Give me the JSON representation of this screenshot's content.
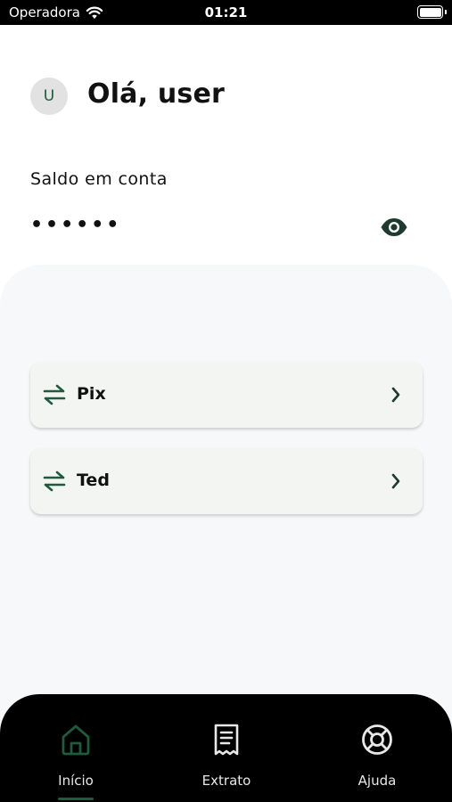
{
  "status_bar": {
    "carrier": "Operadora",
    "time": "01:21"
  },
  "header": {
    "avatar_initial": "U",
    "greeting": "Olá, user"
  },
  "balance": {
    "label": "Saldo em conta",
    "masked_value": "••••••",
    "visibility_icon": "eye-icon"
  },
  "actions": [
    {
      "label": "Pix",
      "icon": "transfer-arrows-icon"
    },
    {
      "label": "Ted",
      "icon": "transfer-arrows-icon"
    }
  ],
  "bottom_nav": {
    "items": [
      {
        "label": "Início",
        "icon": "home-icon",
        "active": true
      },
      {
        "label": "Extrato",
        "icon": "receipt-icon",
        "active": false
      },
      {
        "label": "Ajuda",
        "icon": "lifebuoy-icon",
        "active": false
      }
    ]
  },
  "colors": {
    "accent": "#1f5a3c",
    "nav_background": "#000000",
    "panel_background": "#f7f8f9"
  }
}
